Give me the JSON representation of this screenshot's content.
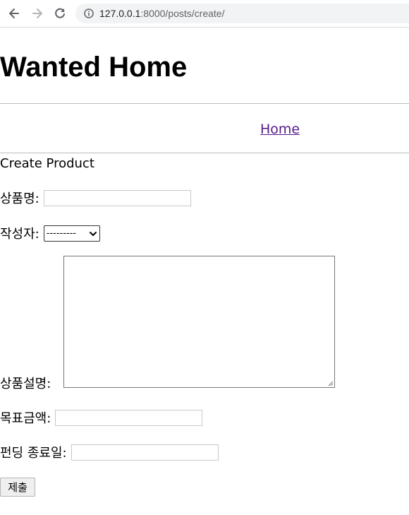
{
  "browser": {
    "url_host": "127.0.0.1",
    "url_rest": ":8000/posts/create/"
  },
  "header": {
    "title": "Wanted Home"
  },
  "nav": {
    "home_label": "Home"
  },
  "form": {
    "title": "Create Product",
    "product_name_label": "상품명:",
    "author_label": "작성자:",
    "author_selected": "---------",
    "description_label": "상품설명:",
    "target_amount_label": "목표금액:",
    "end_date_label": "펀딩 종료일:",
    "submit_label": "제출"
  }
}
